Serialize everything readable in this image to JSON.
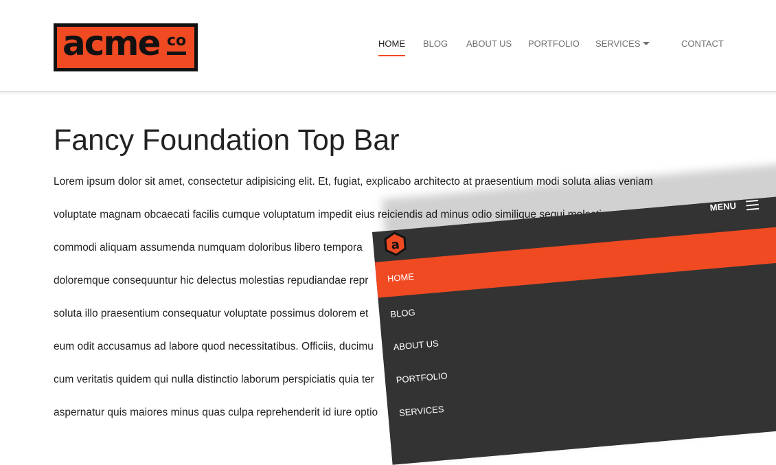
{
  "header": {
    "logo": {
      "main_text": "acme",
      "sub_text": "co"
    },
    "nav": [
      {
        "label": "HOME",
        "active": true
      },
      {
        "label": "BLOG",
        "active": false
      },
      {
        "label": "ABOUT US",
        "active": false
      },
      {
        "label": "PORTFOLIO",
        "active": false
      },
      {
        "label": "SERVICES",
        "active": false,
        "has_dropdown": true
      },
      {
        "label": "CONTACT",
        "active": false
      }
    ]
  },
  "content": {
    "title": "Fancy Foundation Top Bar",
    "paragraph_lines": [
      "Lorem ipsum dolor sit amet, consectetur adipisicing elit. Et, fugiat, explicabo architecto at praesentium modi soluta alias veniam",
      "voluptate magnam obcaecati facilis cumque voluptatum impedit eius reiciendis ad minus odio similique sequi molestiae",
      "commodi aliquam assumenda numquam doloribus libero tempora",
      "doloremque consequuntur hic delectus molestias repudiandae repr",
      "soluta illo praesentium consequatur voluptate possimus dolorem et",
      "eum odit accusamus ad labore quod necessitatibus. Officiis, ducimu",
      "cum veritatis quidem qui nulla distinctio laborum perspiciatis quia ter",
      "aspernatur quis maiores minus quas culpa reprehenderit id iure optio"
    ]
  },
  "mobile": {
    "logo_letter": "a",
    "menu_label": "MENU",
    "items": [
      {
        "label": "HOME",
        "active": true
      },
      {
        "label": "BLOG",
        "active": false
      },
      {
        "label": "ABOUT US",
        "active": false
      },
      {
        "label": "PORTFOLIO",
        "active": false
      },
      {
        "label": "SERVICES",
        "active": false
      }
    ]
  },
  "colors": {
    "accent": "#f04a23",
    "dark": "#333333",
    "logo_border": "#111111",
    "nav_text": "#6f6f6f",
    "body_text": "#222222"
  },
  "icons": {
    "services_dropdown": "caret-down-icon",
    "mobile_menu": "hamburger-icon",
    "mobile_logo": "hexagon-a-logo"
  }
}
